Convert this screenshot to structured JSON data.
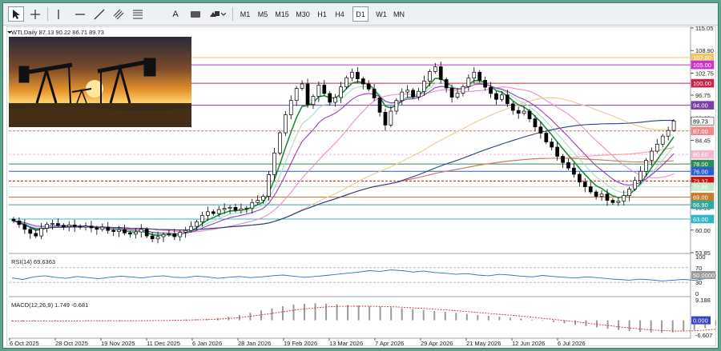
{
  "toolbar": {
    "tools": [
      {
        "name": "cursor-icon"
      },
      {
        "name": "crosshair-icon"
      },
      {
        "name": "vertical-line-icon"
      },
      {
        "name": "horizontal-line-icon"
      },
      {
        "name": "trendline-icon"
      },
      {
        "name": "channel-icon"
      },
      {
        "name": "fibonacci-icon"
      },
      {
        "name": "text-tool-icon"
      },
      {
        "name": "label-tool-icon"
      },
      {
        "name": "shapes-menu-icon"
      }
    ],
    "text_tool_label": "A",
    "timeframes": [
      "M1",
      "M5",
      "M15",
      "M30",
      "H1",
      "H4",
      "D1",
      "W1",
      "MN"
    ],
    "active_timeframe": "D1"
  },
  "chart_header": {
    "symbol_line": "WTI,Daily  87.13 90.22 86.71 89.73"
  },
  "price_axis": {
    "ticks": [
      "115.05",
      "108.90",
      "102.75",
      "96.75",
      "90.60",
      "84.45",
      "78.30",
      "72.15",
      "66.15",
      "60.00",
      "53.85"
    ],
    "markers": [
      {
        "label": "107.00",
        "value": 107.0,
        "bg": "#f5c26b",
        "fg": "#ffffff"
      },
      {
        "label": "105.00",
        "value": 105.0,
        "bg": "#cc33cc",
        "fg": "#ffffff"
      },
      {
        "label": "100.00",
        "value": 100.0,
        "bg": "#cc2244",
        "fg": "#ffffff"
      },
      {
        "label": "94.00",
        "value": 94.0,
        "bg": "#7a3fa8",
        "fg": "#ffffff"
      },
      {
        "label": "89.73",
        "value": 89.73,
        "bg": "#ffffff",
        "fg": "#000000"
      },
      {
        "label": "87.00",
        "value": 87.0,
        "bg": "#f08a8a",
        "fg": "#ffffff"
      },
      {
        "label": "80.60",
        "value": 80.6,
        "bg": "#f2b8d2",
        "fg": "#ffffff"
      },
      {
        "label": "78.00",
        "value": 78.0,
        "bg": "#2e8b57",
        "fg": "#ffffff"
      },
      {
        "label": "76.00",
        "value": 76.0,
        "bg": "#2b5fd1",
        "fg": "#ffffff"
      },
      {
        "label": "73.37",
        "value": 73.37,
        "bg": "#cc1111",
        "fg": "#ffffff"
      },
      {
        "label": "72.00",
        "value": 71.8,
        "bg": "#c8e8c8",
        "fg": "#ffffff"
      },
      {
        "label": "69.00",
        "value": 69.0,
        "bg": "#c77a2a",
        "fg": "#ffffff"
      },
      {
        "label": "66.90",
        "value": 66.9,
        "bg": "#30a89a",
        "fg": "#ffffff"
      },
      {
        "label": "63.00",
        "value": 63.0,
        "bg": "#33b5c8",
        "fg": "#ffffff"
      }
    ]
  },
  "levels": [
    {
      "value": 107.0,
      "color": "#f5c26b",
      "dash": "solid"
    },
    {
      "value": 105.0,
      "color": "#cc33cc",
      "dash": "solid"
    },
    {
      "value": 100.0,
      "color": "#cc2244",
      "dash": "solid"
    },
    {
      "value": 94.0,
      "color": "#7a3fa8",
      "dash": "solid"
    },
    {
      "value": 87.0,
      "color": "#e06060",
      "dash": "dash"
    },
    {
      "value": 80.6,
      "color": "#f2b8d2",
      "dash": "dash"
    },
    {
      "value": 78.0,
      "color": "#2e8b57",
      "dash": "solid"
    },
    {
      "value": 76.0,
      "color": "#2b5fd1",
      "dash": "solid"
    },
    {
      "value": 73.37,
      "color": "#cc1111",
      "dash": "dash"
    },
    {
      "value": 71.8,
      "color": "#bde0bd",
      "dash": "solid"
    },
    {
      "value": 69.0,
      "color": "#c77a2a",
      "dash": "solid"
    },
    {
      "value": 66.9,
      "color": "#30a89a",
      "dash": "solid"
    },
    {
      "value": 63.0,
      "color": "#33b5c8",
      "dash": "solid"
    }
  ],
  "rsi": {
    "label": "RSI(14) 69.6363",
    "ticks": [
      "100",
      "70",
      "50",
      "30",
      "0"
    ],
    "marker": "50.0000",
    "values": [
      42,
      38,
      45,
      48,
      44,
      41,
      46,
      43,
      40,
      44,
      47,
      45,
      42,
      46,
      48,
      44,
      43,
      47,
      45,
      41,
      44,
      46,
      43,
      45,
      48,
      50,
      47,
      44,
      46,
      49,
      52,
      55,
      58,
      62,
      60,
      64,
      62,
      58,
      61,
      57,
      55,
      52,
      54,
      50,
      48,
      52,
      50,
      47,
      45,
      49,
      46,
      44,
      42,
      45,
      43,
      40,
      38,
      36,
      39,
      37,
      34,
      36,
      38,
      36,
      40,
      48,
      55,
      60,
      65,
      69.6
    ]
  },
  "macd": {
    "label": "MACD(12,26,9) 1.749 -0.681",
    "ticks": [
      "9.188",
      "0.000",
      "-6.607"
    ],
    "marker": "0.000",
    "histogram": [
      -0.4,
      -0.5,
      -0.3,
      -0.2,
      -0.3,
      -0.4,
      -0.3,
      -0.2,
      -0.1,
      -0.2,
      -0.3,
      -0.2,
      -0.1,
      0.0,
      0.1,
      0.2,
      0.3,
      0.4,
      0.6,
      1.0,
      1.6,
      2.4,
      3.4,
      4.4,
      5.4,
      6.3,
      7.0,
      7.4,
      7.6,
      7.5,
      7.2,
      6.9,
      6.6,
      6.3,
      6.1,
      5.8,
      5.4,
      5.0,
      4.6,
      4.2,
      3.8,
      3.3,
      2.9,
      2.4,
      2.0,
      1.6,
      1.2,
      0.8,
      0.3,
      -0.2,
      -0.8,
      -1.4,
      -2.0,
      -2.6,
      -3.2,
      -3.8,
      -4.3,
      -4.8,
      -5.2,
      -5.5,
      -5.6,
      -5.4,
      -5.0,
      -4.3,
      -3.5,
      -2.6,
      -1.7,
      -0.9,
      -0.3,
      1.7
    ],
    "signal": [
      -0.3,
      -0.3,
      -0.3,
      -0.3,
      -0.3,
      -0.3,
      -0.3,
      -0.2,
      -0.2,
      -0.2,
      -0.2,
      -0.2,
      -0.2,
      -0.1,
      -0.1,
      0.0,
      0.1,
      0.2,
      0.3,
      0.5,
      0.8,
      1.2,
      1.8,
      2.4,
      3.1,
      3.8,
      4.5,
      5.1,
      5.6,
      6.0,
      6.2,
      6.3,
      6.3,
      6.3,
      6.2,
      6.1,
      5.9,
      5.6,
      5.3,
      5.0,
      4.7,
      4.3,
      3.9,
      3.5,
      3.1,
      2.7,
      2.3,
      1.9,
      1.4,
      0.9,
      0.4,
      -0.1,
      -0.6,
      -1.2,
      -1.8,
      -2.3,
      -2.9,
      -3.4,
      -3.9,
      -4.3,
      -4.6,
      -4.8,
      -4.8,
      -4.7,
      -4.4,
      -4.0,
      -3.4,
      -2.8,
      -2.1,
      -0.7
    ]
  },
  "time_axis": {
    "labels": [
      "6 Oct 2025",
      "28 Oct 2025",
      "19 Nov 2025",
      "11 Dec 2025",
      "6 Jan 2026",
      "28 Jan 2026",
      "19 Feb 2026",
      "13 Mar 2026",
      "7 Apr 2026",
      "29 Apr 2026",
      "21 May 2026",
      "12 Jun 2026",
      "6 Jul 2026"
    ]
  },
  "chart_data": {
    "type": "candlestick",
    "symbol": "WTI",
    "timeframe": "Daily",
    "last": {
      "open": 87.13,
      "high": 90.22,
      "low": 86.71,
      "close": 89.73
    },
    "ylim": [
      53.85,
      115.05
    ],
    "closes": [
      62.5,
      61.5,
      60.2,
      59.1,
      58.4,
      60.5,
      61.6,
      61.8,
      61.3,
      60.9,
      61.4,
      61.0,
      60.8,
      61.1,
      60.6,
      60.2,
      60.8,
      59.9,
      59.6,
      60.1,
      59.2,
      58.9,
      59.5,
      60.2,
      58.4,
      57.6,
      58.2,
      58.8,
      59.0,
      58.2,
      59.4,
      59.9,
      61.0,
      62.2,
      64.0,
      65.0,
      64.5,
      65.6,
      65.9,
      66.2,
      65.4,
      65.8,
      66.0,
      67.5,
      68.1,
      69.2,
      75.1,
      81.0,
      86.5,
      91.4,
      95.3,
      98.6,
      99.8,
      94.2,
      96.4,
      99.5,
      97.2,
      94.8,
      96.1,
      99.0,
      101.5,
      103.0,
      101.2,
      99.8,
      98.4,
      96.0,
      92.1,
      88.6,
      92.4,
      95.3,
      97.6,
      98.1,
      96.3,
      97.8,
      100.6,
      103.2,
      104.5,
      101.0,
      98.7,
      96.2,
      97.3,
      99.1,
      101.4,
      103.0,
      100.8,
      98.9,
      97.2,
      95.6,
      96.8,
      94.4,
      92.6,
      91.8,
      92.4,
      90.3,
      88.1,
      86.4,
      84.0,
      82.6,
      80.1,
      78.4,
      76.9,
      75.2,
      73.1,
      71.8,
      70.4,
      69.2,
      69.8,
      68.1,
      67.5,
      67.9,
      69.4,
      71.2,
      73.5,
      76.0,
      79.0,
      81.5,
      83.4,
      85.6,
      87.13,
      89.73
    ],
    "ma_lines": [
      {
        "name": "SMA20",
        "color": "#e58fd0"
      },
      {
        "name": "SMA50",
        "color": "#f0c890"
      },
      {
        "name": "SMA100",
        "color": "#f5a0a0"
      },
      {
        "name": "SMA200",
        "color": "#c87c5c"
      },
      {
        "name": "EMA9",
        "color": "#1f8a3a"
      },
      {
        "name": "EMA14",
        "color": "#9fe0c0"
      },
      {
        "name": "SMA150",
        "color": "#2a3f8f"
      },
      {
        "name": "EMA20",
        "color": "#9b3db8"
      }
    ]
  }
}
